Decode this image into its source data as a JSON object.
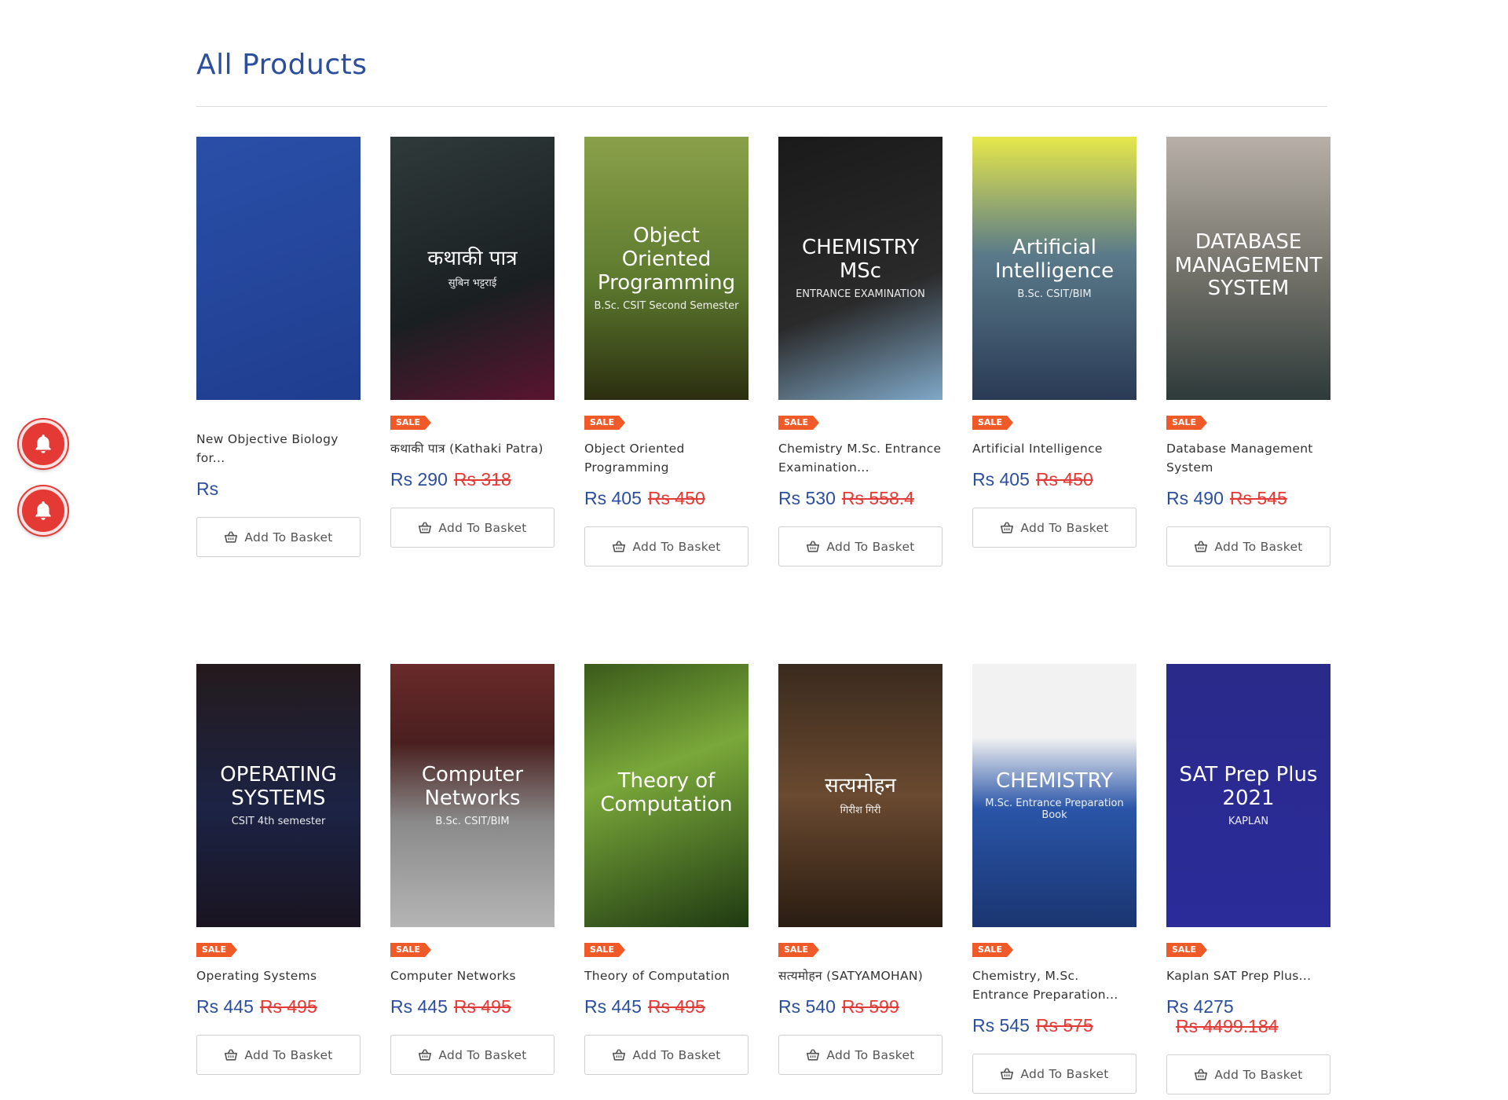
{
  "page": {
    "title": "All Products"
  },
  "currency": "Rs",
  "sale_badge": "SALE",
  "add_to_basket": "Add To Basket",
  "colors": {
    "title": "#2b4f9e",
    "price": "#2b4f9e",
    "old_price": "#e53935",
    "sale_badge": "#f05a28",
    "bell": "#e53935"
  },
  "products": [
    {
      "name": "New Objective Biology for...",
      "price": "Rs",
      "old_price": "",
      "sale": false,
      "cover": {
        "line1": "",
        "line2": "",
        "bg": "linear-gradient(160deg,#2a4fa8,#1f3d8f)"
      }
    },
    {
      "name": "कथाकी पात्र (Kathaki Patra)",
      "price": "Rs 290",
      "old_price": "Rs 318",
      "sale": true,
      "cover": {
        "line1": "कथाकी पात्र",
        "line2": "सुबिन भट्टराई",
        "bg": "linear-gradient(160deg,#2f3a3a,#1a1f22 60%,#5a1430)"
      }
    },
    {
      "name": "Object Oriented Programming",
      "price": "Rs 405",
      "old_price": "Rs 450",
      "sale": true,
      "cover": {
        "line1": "Object Oriented Programming",
        "line2": "B.Sc. CSIT Second Semester",
        "bg": "linear-gradient(180deg,#8aa04a,#5d7a2e 55%,#2b2e10)"
      }
    },
    {
      "name": "Chemistry M.Sc. Entrance Examination...",
      "price": "Rs 530",
      "old_price": "Rs 558.4",
      "sale": true,
      "cover": {
        "line1": "CHEMISTRY MSc",
        "line2": "ENTRANCE EXAMINATION",
        "bg": "linear-gradient(160deg,#1a1a1a,#2a2a2a 60%,#7fa8c8)"
      }
    },
    {
      "name": "Artificial Intelligence",
      "price": "Rs 405",
      "old_price": "Rs 450",
      "sale": true,
      "cover": {
        "line1": "Artificial Intelligence",
        "line2": "B.Sc. CSIT/BIM",
        "bg": "linear-gradient(180deg,#e6e84a,#5a7a8a 45%,#2a3a55)"
      }
    },
    {
      "name": "Database Management System",
      "price": "Rs 490",
      "old_price": "Rs 545",
      "sale": true,
      "cover": {
        "line1": "DATABASE MANAGEMENT SYSTEM",
        "line2": "",
        "bg": "linear-gradient(180deg,#b8b0a8,#6e6e66 55%,#2e3a3a)"
      }
    },
    {
      "name": "Operating Systems",
      "price": "Rs 445",
      "old_price": "Rs 495",
      "sale": true,
      "cover": {
        "line1": "OPERATING SYSTEMS",
        "line2": "CSIT 4th semester",
        "bg": "linear-gradient(180deg,#241a1c,#1c2345 55%,#1a1420)"
      }
    },
    {
      "name": "Computer Networks",
      "price": "Rs 445",
      "old_price": "Rs 495",
      "sale": true,
      "cover": {
        "line1": "Computer Networks",
        "line2": "B.Sc. CSIT/BIM",
        "bg": "linear-gradient(180deg,#6a2a2a,#4a1f1f 30%,#8a8a8a 60%,#b5b5b5)"
      }
    },
    {
      "name": "Theory of Computation",
      "price": "Rs 445",
      "old_price": "Rs 495",
      "sale": true,
      "cover": {
        "line1": "Theory of Computation",
        "line2": "",
        "bg": "linear-gradient(160deg,#3a5a1a,#7aa83a 40%,#1f3a12)"
      }
    },
    {
      "name": "सत्यमोहन (SATYAMOHAN)",
      "price": "Rs 540",
      "old_price": "Rs 599",
      "sale": true,
      "cover": {
        "line1": "सत्यमोहन",
        "line2": "गिरीश गिरी",
        "bg": "linear-gradient(180deg,#3a2a1e,#6a4a30 50%,#2a1c12)"
      }
    },
    {
      "name": "Chemistry, M.Sc. Entrance Preparation...",
      "price": "Rs 545",
      "old_price": "Rs 575",
      "sale": true,
      "cover": {
        "line1": "CHEMISTRY",
        "line2": "M.Sc. Entrance Preparation Book",
        "bg": "linear-gradient(180deg,#f2f2f2 0%,#f2f2f2 28%,#2a55a8 55%,#1a3570)"
      }
    },
    {
      "name": "Kaplan SAT Prep Plus...",
      "price": "Rs 4275",
      "old_price": "Rs 4499.184",
      "sale": true,
      "cover": {
        "line1": "SAT Prep Plus 2021",
        "line2": "KAPLAN",
        "bg": "linear-gradient(180deg,#2a2a8a,#2b2b9a)"
      }
    }
  ]
}
